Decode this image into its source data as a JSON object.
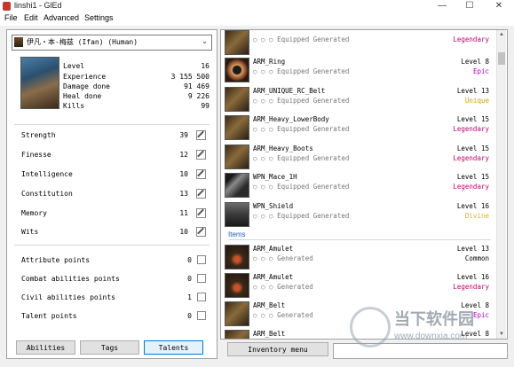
{
  "window": {
    "title": "linshi1 - GlEd",
    "minimize": "—",
    "maximize": "☐",
    "close": "✕"
  },
  "menu": [
    "File",
    "Edit",
    "Advanced",
    "Settings"
  ],
  "character": {
    "selector": "伊凡・本-梅兹 (Ifan) (Human)",
    "stats": [
      {
        "label": "Level",
        "value": "16"
      },
      {
        "label": "Experience",
        "value": "3 155 500"
      },
      {
        "label": "Damage done",
        "value": "91 469"
      },
      {
        "label": "Heal done",
        "value": "9 226"
      },
      {
        "label": "Kills",
        "value": "99"
      }
    ],
    "attributes": [
      {
        "label": "Strength",
        "value": "39"
      },
      {
        "label": "Finesse",
        "value": "12"
      },
      {
        "label": "Intelligence",
        "value": "10"
      },
      {
        "label": "Constitution",
        "value": "13"
      },
      {
        "label": "Memory",
        "value": "11"
      },
      {
        "label": "Wits",
        "value": "10"
      }
    ],
    "points": [
      {
        "label": "Attribute points",
        "value": "0"
      },
      {
        "label": "Combat abilities points",
        "value": "0"
      },
      {
        "label": "Civil abilities points",
        "value": "1"
      },
      {
        "label": "Talent points",
        "value": "0"
      }
    ]
  },
  "buttons": {
    "abilities": "Abilities",
    "tags": "Tags",
    "talents": "Talents",
    "inventory_menu": "Inventory menu"
  },
  "equipped_items": [
    {
      "name": "",
      "sub": "○ ○ ○ Equipped Generated",
      "level": "",
      "rarity": "Legendary",
      "rarity_color": "#c0006a",
      "icon": "equipped-item-icon"
    },
    {
      "name": "ARM_Ring",
      "sub": "○ ○ ○ Equipped Generated",
      "level": "Level 8",
      "rarity": "Epic",
      "rarity_color": "#b000d0",
      "icon": "ring-icon"
    },
    {
      "name": "ARM_UNIQUE_RC_Belt",
      "sub": "○ ○ ○ Equipped Generated",
      "level": "Level 13",
      "rarity": "Unique",
      "rarity_color": "#d4a000",
      "icon": "belt-icon"
    },
    {
      "name": "ARM_Heavy_LowerBody",
      "sub": "○ ○ ○ Equipped Generated",
      "level": "Level 15",
      "rarity": "Legendary",
      "rarity_color": "#c0006a",
      "icon": "leg-armor-icon"
    },
    {
      "name": "ARM_Heavy_Boots",
      "sub": "○ ○ ○ Equipped Generated",
      "level": "Level 15",
      "rarity": "Legendary",
      "rarity_color": "#c0006a",
      "icon": "boots-icon"
    },
    {
      "name": "WPN_Mace_1H",
      "sub": "○ ○ ○ Equipped Generated",
      "level": "Level 15",
      "rarity": "Legendary",
      "rarity_color": "#c0006a",
      "icon": "mace-icon"
    },
    {
      "name": "WPN_Shield",
      "sub": "○ ○ ○ Equipped Generated",
      "level": "Level 16",
      "rarity": "Divine",
      "rarity_color": "#e0b020",
      "icon": "shield-icon"
    }
  ],
  "items_section": "Items",
  "items": [
    {
      "name": "ARM_Amulet",
      "sub": "○ ○ ○ Generated",
      "level": "Level 13",
      "rarity": "Common",
      "rarity_color": "#000000",
      "icon": "amulet-icon"
    },
    {
      "name": "ARM_Amulet",
      "sub": "○ ○ ○ Generated",
      "level": "Level 16",
      "rarity": "Legendary",
      "rarity_color": "#c0006a",
      "icon": "amulet-icon"
    },
    {
      "name": "ARM_Belt",
      "sub": "○ ○ ○ Generated",
      "level": "Level 8",
      "rarity": "Epic",
      "rarity_color": "#b000d0",
      "icon": "belt-icon"
    },
    {
      "name": "ARM_Belt",
      "sub": "",
      "level": "Level 8",
      "rarity": "",
      "rarity_color": "#000000",
      "icon": "belt-icon"
    }
  ],
  "watermark": {
    "text": "当下软件园",
    "url": "www.downxia.com"
  }
}
